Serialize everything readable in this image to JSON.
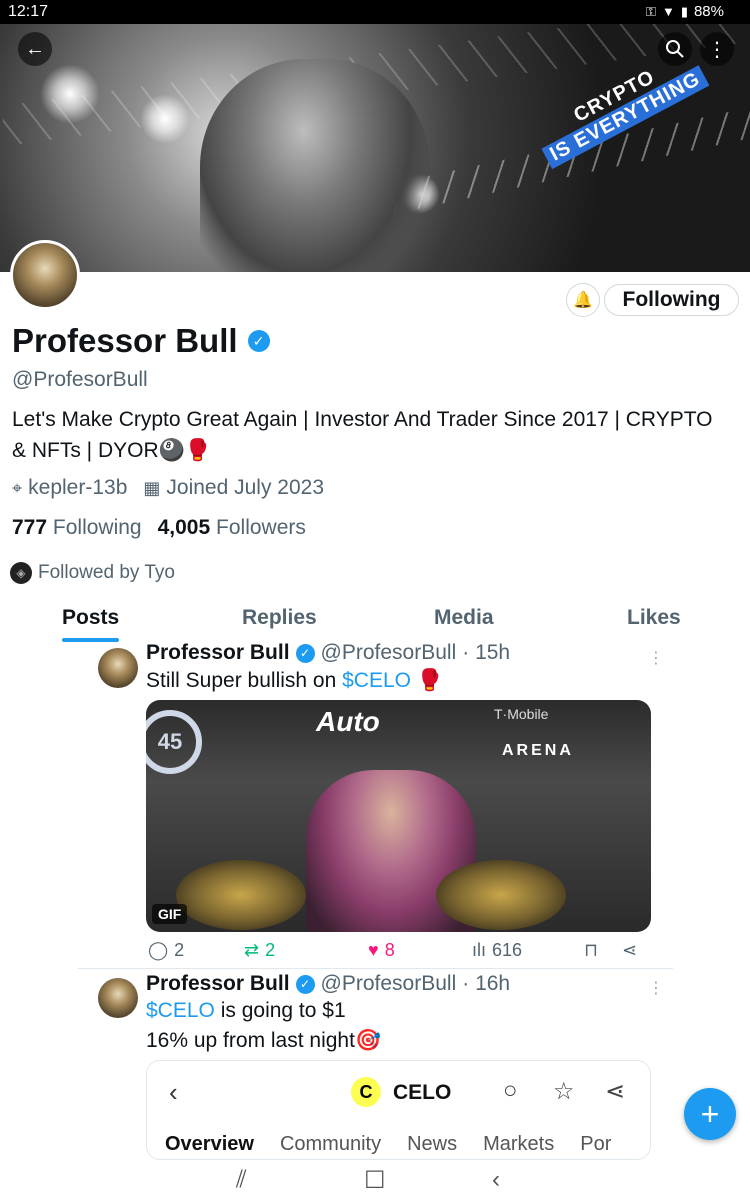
{
  "status_bar": {
    "time": "12:17",
    "battery": "88%"
  },
  "banner": {
    "line1": "CRYPTO",
    "line2": "IS EVERYTHING"
  },
  "header_icons": {
    "back": "arrow-left-icon",
    "search": "search-icon",
    "more": "more-vertical-icon"
  },
  "profile": {
    "name": "Professor Bull",
    "handle": "@ProfesorBull",
    "bio": "Let's Make Crypto Great Again | Investor And Trader Since 2017 | CRYPTO & NFTs | DYOR🎱🥊",
    "location": "kepler-13b",
    "joined": "Joined July 2023",
    "following_count": "777",
    "following_label": "Following",
    "followers_count": "4,005",
    "followers_label": "Followers",
    "followed_by": "Followed by Tyo",
    "follow_button": "Following"
  },
  "tabs": [
    {
      "label": "Posts",
      "active": true
    },
    {
      "label": "Replies",
      "active": false
    },
    {
      "label": "Media",
      "active": false
    },
    {
      "label": "Likes",
      "active": false
    }
  ],
  "posts": [
    {
      "name": "Professor Bull",
      "handle": "@ProfesorBull",
      "time": "· 15h",
      "text_pre": "Still Super bullish on ",
      "cashtag": "$CELO",
      "text_post": " 🥊",
      "media": {
        "gif_label": "GIF",
        "sign1": "Auto",
        "sign2": "ARENA",
        "sign3": "T·Mobile",
        "badge": "45"
      },
      "replies": "2",
      "reposts": "2",
      "likes": "8",
      "views": "616"
    },
    {
      "name": "Professor Bull",
      "handle": "@ProfesorBull",
      "time": "· 16h",
      "cashtag": "$CELO",
      "line1_post": " is going to $1",
      "line2": "16% up from last night🎯",
      "card": {
        "title": "CELO",
        "logo_letter": "C",
        "tabs": [
          "Overview",
          "Community",
          "News",
          "Markets",
          "Por"
        ]
      }
    }
  ],
  "accent_color": "#1d9bf0"
}
